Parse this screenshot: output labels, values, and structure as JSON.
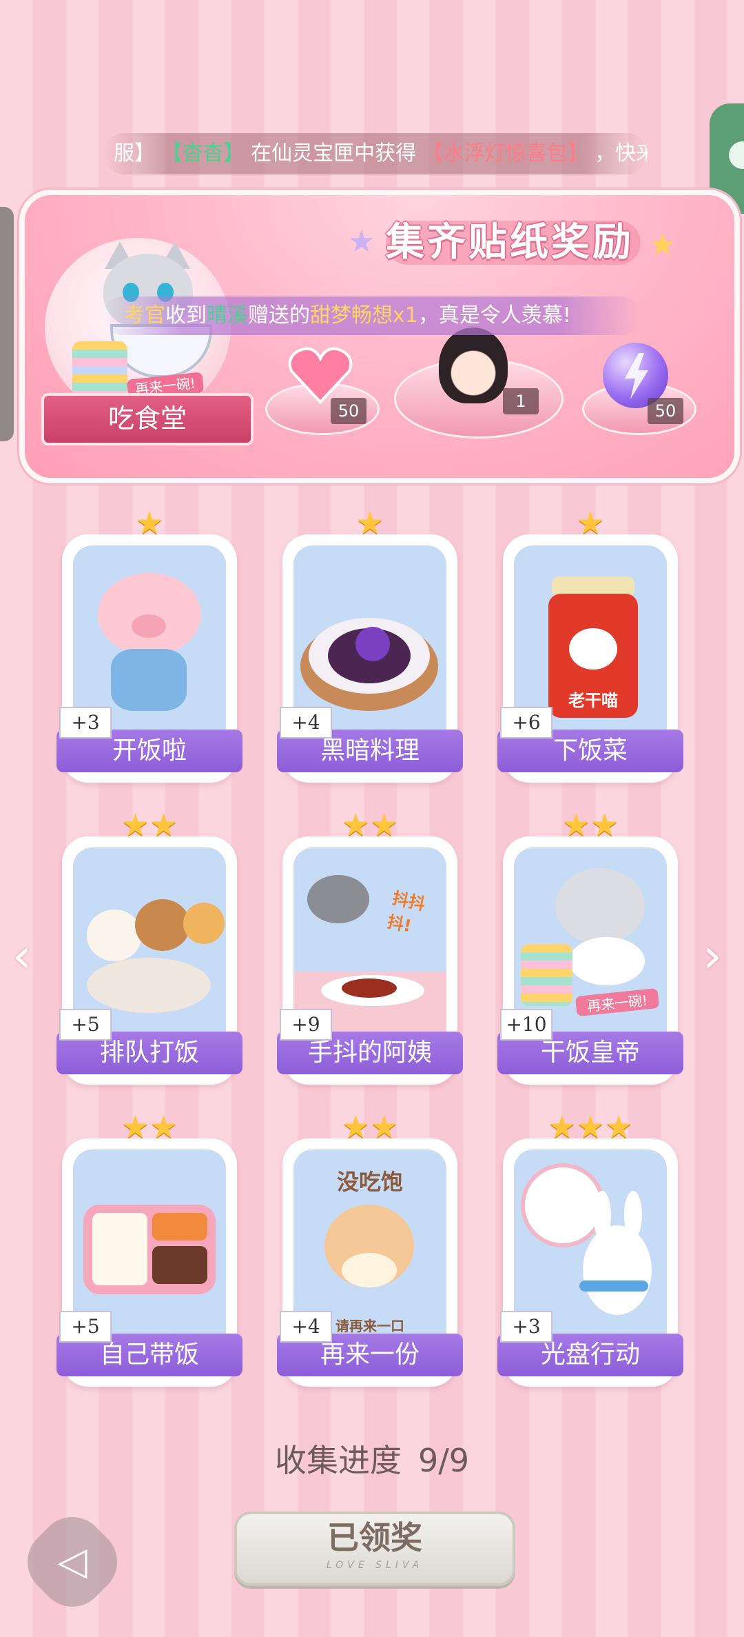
{
  "ticker": {
    "parts": [
      "服】",
      "【杳杳】",
      "在仙灵宝匣中获得",
      "【水浮灯惊喜包】",
      "，快来!"
    ]
  },
  "banner": {
    "title": "集齐贴纸奖励",
    "canteen_label": "吃食堂",
    "badge_text": "再来一碗!",
    "rewards": [
      {
        "name": "pink-heart-gem",
        "count": "50"
      },
      {
        "name": "character-portrait",
        "count": "1"
      },
      {
        "name": "purple-lightning-orb",
        "count": "50"
      }
    ],
    "notice_parts": [
      "考官",
      "收到",
      "晴溪",
      "赠送的",
      "甜梦畅想x1",
      "，真是令人羡慕!"
    ]
  },
  "stickers": [
    {
      "label": "开饭啦",
      "points": "+3",
      "stars": "★",
      "art": "pig"
    },
    {
      "label": "黑暗料理",
      "points": "+4",
      "stars": "★",
      "art": "dark-dish"
    },
    {
      "label": "下饭菜",
      "points": "+6",
      "stars": "★",
      "art": "chili-jar",
      "jar_text": "老干喵"
    },
    {
      "label": "排队打饭",
      "points": "+5",
      "stars": "★★",
      "art": "animal-queue"
    },
    {
      "label": "手抖的阿姨",
      "points": "+9",
      "stars": "★★",
      "art": "ladle",
      "caption": "抖抖抖!"
    },
    {
      "label": "干饭皇帝",
      "points": "+10",
      "stars": "★★",
      "art": "cat-rice",
      "caption": "再来一碗!"
    },
    {
      "label": "自己带饭",
      "points": "+5",
      "stars": "★★",
      "art": "bento"
    },
    {
      "label": "再来一份",
      "points": "+4",
      "stars": "★★",
      "art": "hamster",
      "caption_top": "没吃饱",
      "caption_bottom": "请再来一口"
    },
    {
      "label": "光盘行动",
      "points": "+3",
      "stars": "★★★",
      "art": "bunny-plate"
    }
  ],
  "progress": {
    "label": "收集进度",
    "value": "9/9"
  },
  "claim": {
    "label": "已领奖",
    "sub": "LOVE SLIVA"
  },
  "icons": {
    "left_arrow": "‹",
    "right_arrow": "›",
    "back": "◁"
  },
  "colors": {
    "label_bar": "#9a6ae0",
    "star": "#ffc63d",
    "banner": "#ffb7c9"
  }
}
